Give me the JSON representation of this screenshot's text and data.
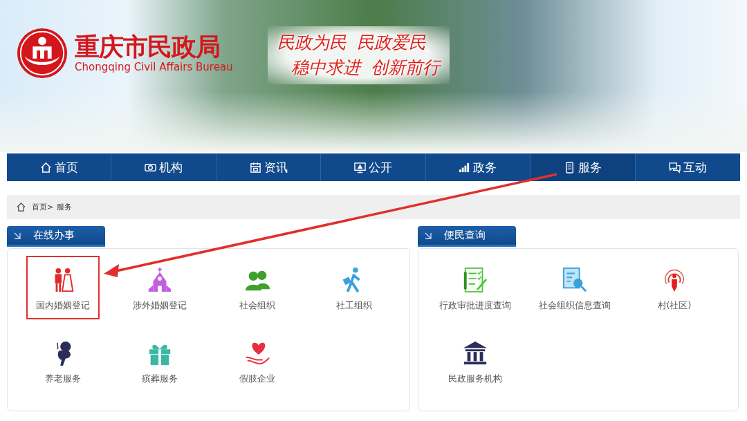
{
  "banner": {
    "title": "重庆市民政局",
    "subtitle": "Chongqing Civil Affairs Bureau",
    "slogans": [
      "民政为民  民政爱民",
      "稳中求进  创新前行"
    ]
  },
  "nav": [
    {
      "label": "首页",
      "selected": false
    },
    {
      "label": "机构",
      "selected": false
    },
    {
      "label": "资讯",
      "selected": false
    },
    {
      "label": "公开",
      "selected": false
    },
    {
      "label": "政务",
      "selected": false
    },
    {
      "label": "服务",
      "selected": true
    },
    {
      "label": "互动",
      "selected": false
    }
  ],
  "breadcrumb": {
    "home": "首页>",
    "current": "服务"
  },
  "panels": [
    {
      "title": "在线办事",
      "items": [
        {
          "label": "国内婚姻登记",
          "highlighted": true
        },
        {
          "label": "涉外婚姻登记",
          "highlighted": false
        },
        {
          "label": "社会组织",
          "highlighted": false
        },
        {
          "label": "社工组织",
          "highlighted": false
        },
        {
          "label": "养老服务",
          "highlighted": false
        },
        {
          "label": "殡葬服务",
          "highlighted": false
        },
        {
          "label": "假肢企业",
          "highlighted": false
        }
      ]
    },
    {
      "title": "便民查询",
      "items": [
        {
          "label": "行政审批进度查询",
          "highlighted": false
        },
        {
          "label": "社会组织信息查询",
          "highlighted": false
        },
        {
          "label": "村(社区)",
          "highlighted": false
        },
        {
          "label": "民政服务机构",
          "highlighted": false
        }
      ]
    }
  ]
}
